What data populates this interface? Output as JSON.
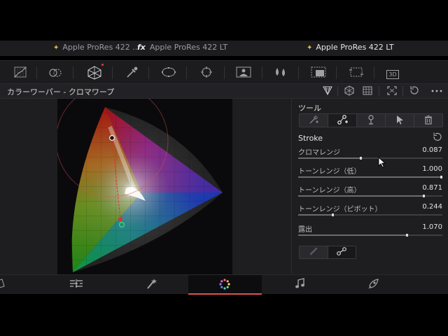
{
  "clip_tabs": [
    {
      "label": "Apple ProRes 422 ...",
      "badge": "fx"
    },
    {
      "label": "Apple ProRes 422 LT"
    },
    {
      "label": "Apple ProRes 422 LT",
      "active": true
    }
  ],
  "toolbar": {
    "icons": [
      "curves-icon",
      "color-warper-icon",
      "warper-mesh-icon",
      "eyedropper-icon",
      "window-icon",
      "tracker-icon",
      "magic-mask-icon",
      "blur-icon",
      "key-icon",
      "sizing-icon",
      "3d-icon"
    ],
    "three_d_label": "3D"
  },
  "header": {
    "title": "カラーワーパー - クロマワープ",
    "icons": [
      "eyedropper-grid-icon",
      "hex-grid-icon",
      "square-grid-icon",
      "expand-icon",
      "reset-icon",
      "more-icon"
    ]
  },
  "panel": {
    "tools_label": "ツール",
    "stroke_label": "Stroke",
    "params": [
      {
        "label": "クロマレンジ",
        "value": "0.087",
        "fraction": 0.43
      },
      {
        "label": "トーンレンジ（低）",
        "value": "1.000",
        "fraction": 1.0
      },
      {
        "label": "トーンレンジ（高）",
        "value": "0.871",
        "fraction": 0.87
      },
      {
        "label": "トーンレンジ（ピボット）",
        "value": "0.244",
        "fraction": 0.24
      },
      {
        "label": "露出",
        "value": "1.070",
        "fraction": 0.75
      }
    ]
  },
  "pages": [
    "media-icon",
    "cut-icon",
    "edit-icon",
    "fusion-icon",
    "color-icon",
    "fairlight-icon",
    "deliver-icon"
  ],
  "colors": {
    "accent": "#e0524a",
    "star": "#e0c23c"
  }
}
